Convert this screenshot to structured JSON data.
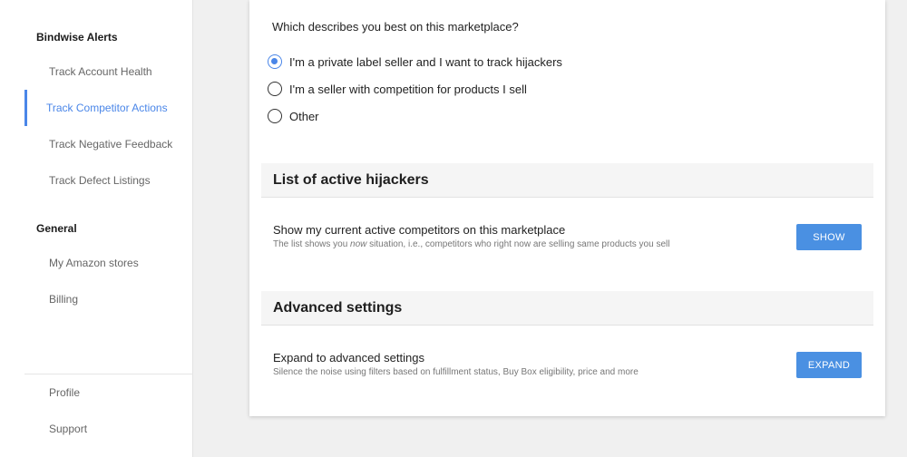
{
  "sidebar": {
    "sections": [
      {
        "title": "Bindwise Alerts",
        "items": [
          {
            "label": "Track Account Health"
          },
          {
            "label": "Track Competitor Actions",
            "active": true
          },
          {
            "label": "Track Negative Feedback"
          },
          {
            "label": "Track Defect Listings"
          }
        ]
      },
      {
        "title": "General",
        "items": [
          {
            "label": "My Amazon stores"
          },
          {
            "label": "Billing"
          }
        ]
      }
    ],
    "footer_items": [
      {
        "label": "Profile"
      },
      {
        "label": "Support"
      }
    ]
  },
  "main": {
    "question": "Which describes you best on this marketplace?",
    "options": [
      {
        "label": "I'm a private label seller and I want to track hijackers",
        "checked": true
      },
      {
        "label": "I'm a seller with competition for products I sell",
        "checked": false
      },
      {
        "label": "Other",
        "checked": false
      }
    ],
    "hijackers": {
      "header": "List of active hijackers",
      "title": "Show my current active competitors on this marketplace",
      "desc_before": "The list shows you ",
      "desc_em": "now",
      "desc_after": " situation, i.e., competitors who right now are selling same products you sell",
      "button": "SHOW"
    },
    "advanced": {
      "header": "Advanced settings",
      "title": "Expand to advanced settings",
      "desc": "Silence the noise using filters based on fulfillment status, Buy Box eligibility, price and more",
      "button": "EXPAND"
    }
  },
  "colors": {
    "accent": "#4a86e8",
    "button": "#4a90e2",
    "background": "#f0f0f0"
  }
}
